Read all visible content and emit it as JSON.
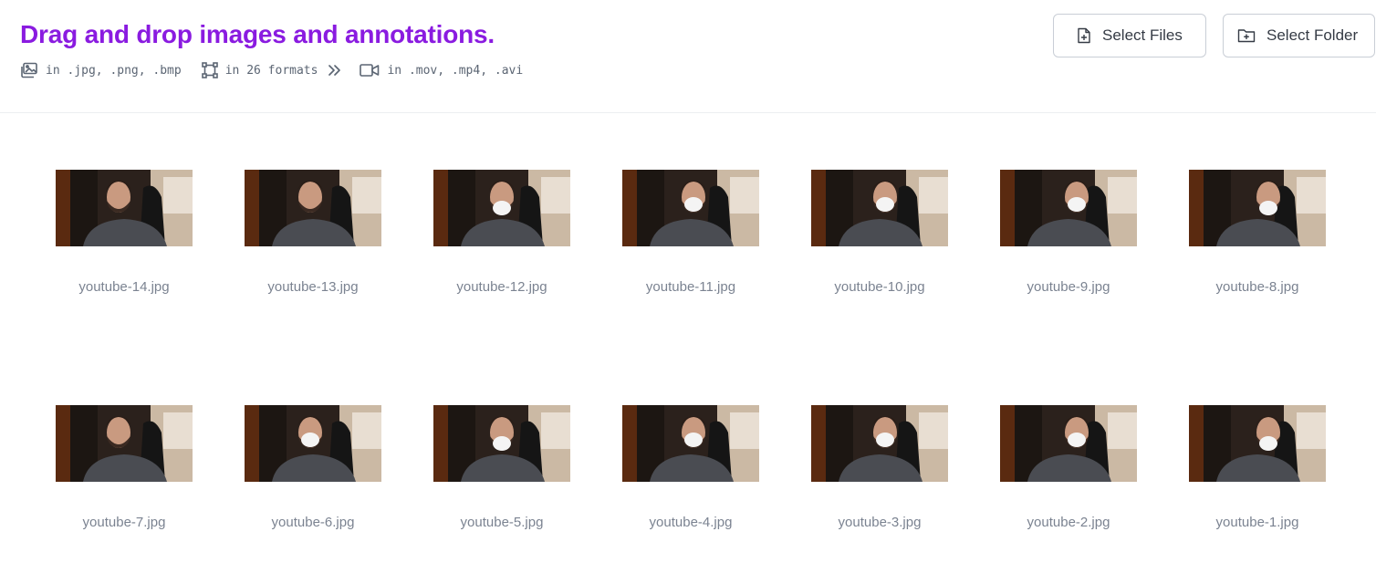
{
  "header": {
    "title": "Drag and drop images and annotations.",
    "formats": {
      "images_text": "in .jpg, .png, .bmp",
      "images_icon": "images-icon",
      "annotations_text": "in 26 formats",
      "annotations_icon": "bounding-box-icon",
      "expand_icon": "chevrons-right-icon",
      "videos_text": "in .mov, .mp4, .avi",
      "videos_icon": "video-camera-icon"
    },
    "select_files": {
      "label": "Select Files",
      "icon": "file-plus-icon"
    },
    "select_folder": {
      "label": "Select Folder",
      "icon": "folder-plus-icon"
    }
  },
  "colors": {
    "title": "#8a1be0",
    "muted_text": "#7b8391",
    "border": "#c9ced6"
  },
  "files": [
    {
      "name": "youtube-14.jpg"
    },
    {
      "name": "youtube-13.jpg"
    },
    {
      "name": "youtube-12.jpg"
    },
    {
      "name": "youtube-11.jpg"
    },
    {
      "name": "youtube-10.jpg"
    },
    {
      "name": "youtube-9.jpg"
    },
    {
      "name": "youtube-8.jpg"
    },
    {
      "name": "youtube-7.jpg"
    },
    {
      "name": "youtube-6.jpg"
    },
    {
      "name": "youtube-5.jpg"
    },
    {
      "name": "youtube-4.jpg"
    },
    {
      "name": "youtube-3.jpg"
    },
    {
      "name": "youtube-2.jpg"
    },
    {
      "name": "youtube-1.jpg"
    }
  ]
}
